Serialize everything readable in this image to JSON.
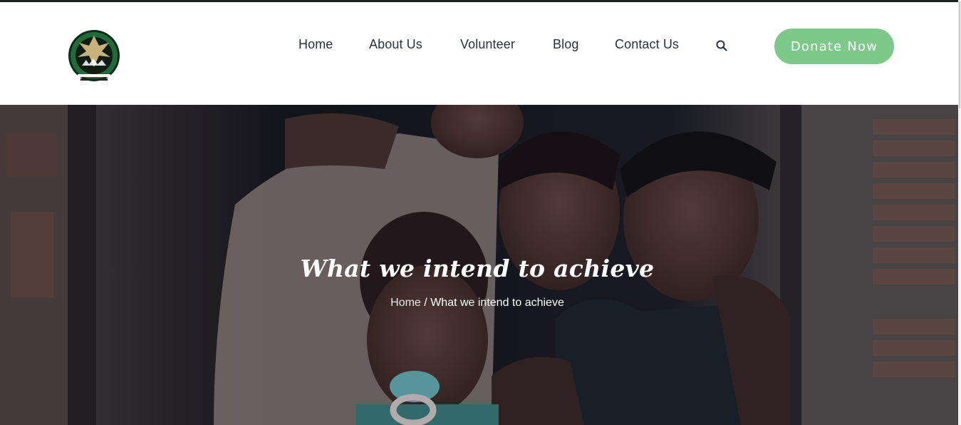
{
  "nav": {
    "items": [
      "Home",
      "About Us",
      "Volunteer",
      "Blog",
      "Contact Us"
    ],
    "donate_label": "Donate Now"
  },
  "icons": {
    "search": "search-icon",
    "logo": "project-logo"
  },
  "colors": {
    "accent": "#7dc98a",
    "nav_text": "#2a3140"
  },
  "hero": {
    "title": "What we intend to achieve",
    "breadcrumb_home": "Home",
    "breadcrumb_separator": "/",
    "breadcrumb_current": "What we intend to achieve"
  }
}
